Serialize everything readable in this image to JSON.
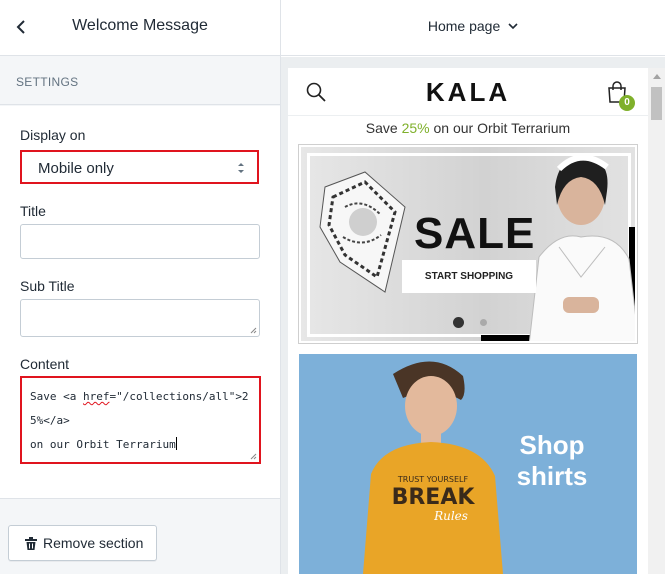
{
  "panel": {
    "title": "Welcome Message",
    "section_label": "SETTINGS",
    "display_on": {
      "label": "Display on",
      "value": "Mobile only"
    },
    "title_field": {
      "label": "Title",
      "value": ""
    },
    "subtitle_field": {
      "label": "Sub Title",
      "value": ""
    },
    "content_field": {
      "label": "Content",
      "text_before": "Save <a ",
      "text_spell": "href",
      "text_after": "=\"/collections/all\">25%</a>\non our Orbit Terrarium"
    },
    "remove_label": "Remove section"
  },
  "preview": {
    "page_select": "Home page",
    "logo": "KALA",
    "cart_count": "0",
    "welcome": {
      "before": "Save ",
      "highlight": "25%",
      "after": " on our Orbit Terrarium"
    },
    "hero": {
      "headline": "SALE",
      "button": "START SHOPPING"
    },
    "banner2": {
      "line1": "Shop",
      "line2": "shirts"
    }
  },
  "colors": {
    "accent_green": "#7fb02b",
    "highlight_red": "#e0141e",
    "banner_blue": "#7db0d9"
  }
}
